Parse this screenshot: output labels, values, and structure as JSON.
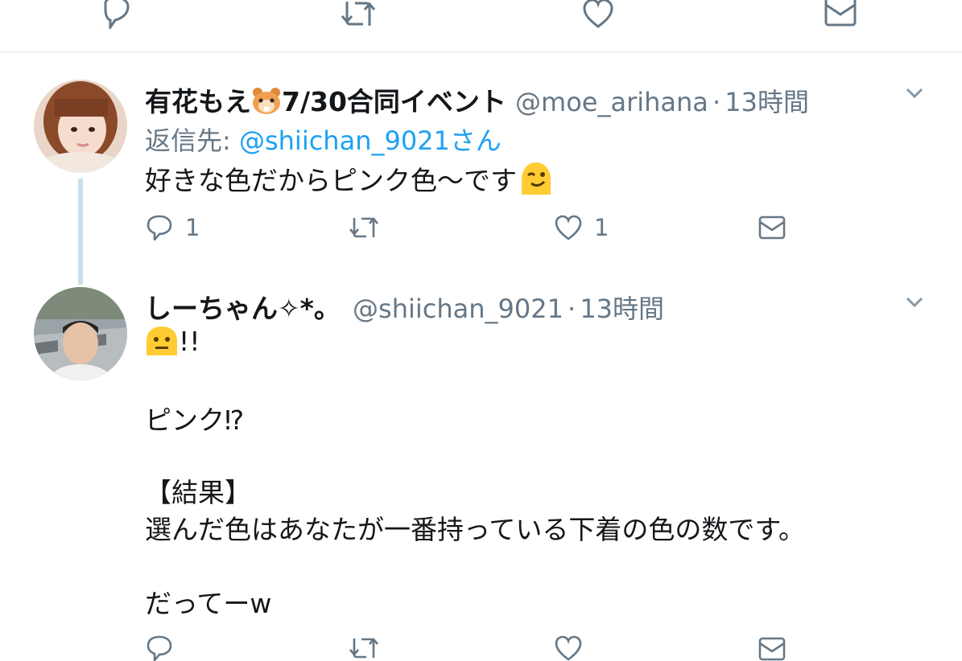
{
  "top_actions": {
    "icons": [
      "reply-icon",
      "retweet-icon",
      "like-icon",
      "dm-icon"
    ]
  },
  "tweets": [
    {
      "display_name": "有花もえ",
      "name_emoji": "hamster-emoji",
      "name_suffix": "7/30合同イベント",
      "handle": "@moe_arihana",
      "separator": "·",
      "time": "13時間",
      "reply_to_label": "返信先: ",
      "reply_to_handle": "@shiichan_9021さん",
      "text_line1": "好きな色だからピンク色〜です",
      "text_emoji": "winking-face-emoji",
      "reply_count": "1",
      "retweet_count": "",
      "like_count": "1"
    },
    {
      "display_name": "しーちゃん✧*。",
      "handle": "@shiichan_9021",
      "separator": "·",
      "time": "13時間",
      "emoji_lead": "neutral-face-emoji",
      "line1": "!!",
      "line2": "ピンク⁉",
      "line3": "【結果】",
      "line4": "選んだ色はあなたが一番持っている下着の色の数です。",
      "line5": "だってーw"
    }
  ],
  "colors": {
    "link": "#1da1f2",
    "secondary_text": "#657786",
    "thread_line": "#c8e0eb",
    "divider": "#e1e8ed",
    "emoji_yellow": "#ffcc33"
  }
}
